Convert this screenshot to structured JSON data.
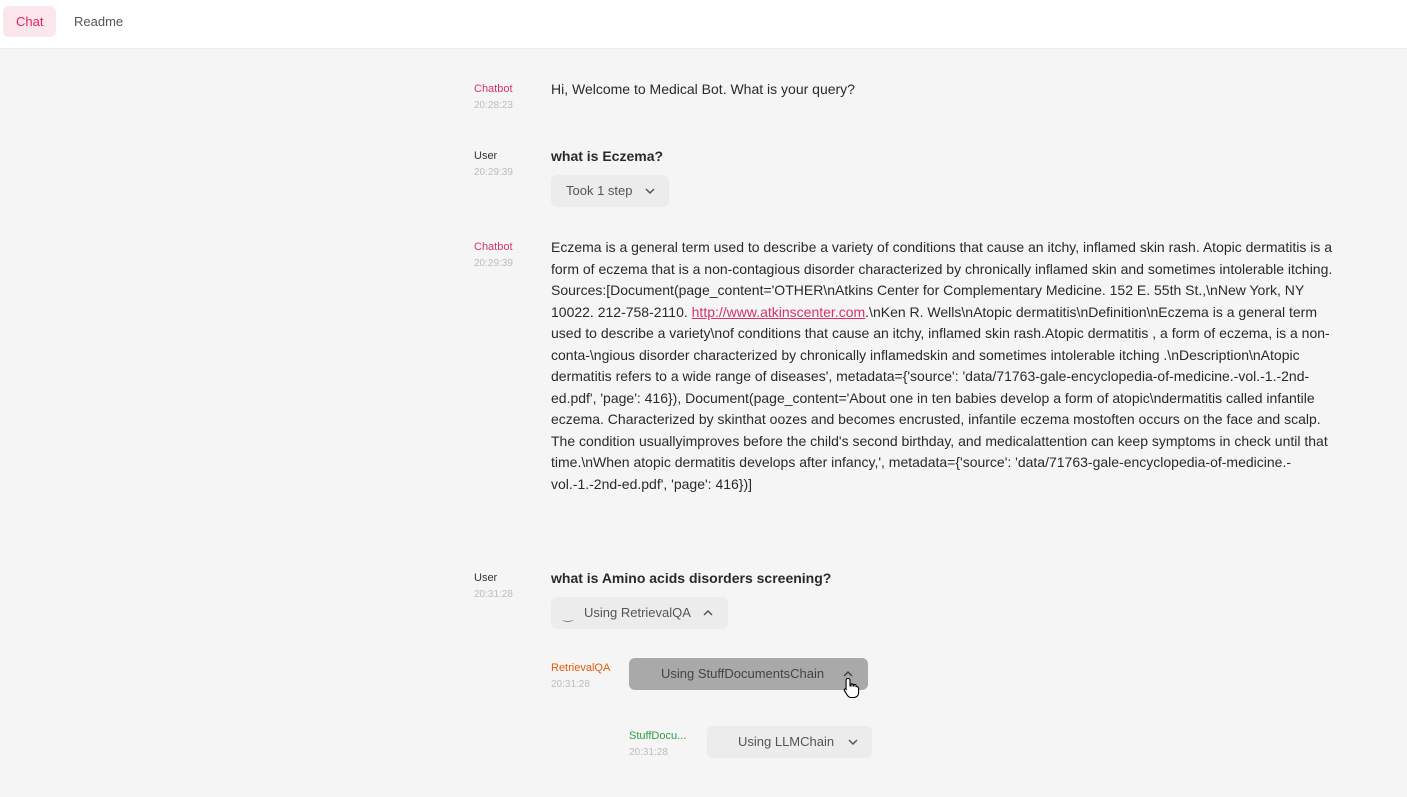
{
  "tabs": [
    {
      "label": "Chat",
      "active": true
    },
    {
      "label": "Readme",
      "active": false
    }
  ],
  "messages": [
    {
      "author": "Chatbot",
      "time": "20:28:23",
      "text": "Hi, Welcome to Medical Bot. What is your query?"
    },
    {
      "author": "User",
      "time": "20:29:39",
      "text": "what is Eczema?",
      "step_label": "Took 1 step"
    },
    {
      "author": "Chatbot",
      "time": "20:29:39",
      "text_before_link": "Eczema is a general term used to describe a variety of conditions that cause an itchy, inflamed skin rash. Atopic dermatitis is a form of eczema that is a non-contagious disorder characterized by chronically inflamed skin and sometimes intolerable itching.\nSources:[Document(page_content='OTHER\\nAtkins Center for Complementary Medicine. 152 E. 55th St.,\\nNew York, NY 10022. 212-758-2110. ",
      "link": "http://www.atkinscenter.com",
      "text_after_link": ".\\nKen R. Wells\\nAtopic dermatitis\\nDefinition\\nEczema is a general term used to describe a variety\\nof conditions that cause an itchy, inflamed skin rash.Atopic dermatitis , a form of eczema, is a non-conta-\\ngious disorder characterized by chronically inflamedskin and sometimes intolerable itching .\\nDescription\\nAtopic dermatitis refers to a wide range of diseases', metadata={'source': 'data/71763-gale-encyclopedia-of-medicine.-vol.-1.-2nd-ed.pdf', 'page': 416}), Document(page_content='About one in ten babies develop a form of atopic\\ndermatitis called infantile eczema. Characterized by skinthat oozes and becomes encrusted, infantile eczema mostoften occurs on the face and scalp. The condition usuallyimproves before the child's second birthday, and medicalattention can keep symptoms in check until that time.\\nWhen atopic dermatitis develops after infancy,', metadata={'source': 'data/71763-gale-encyclopedia-of-medicine.-vol.-1.-2nd-ed.pdf', 'page': 416})]"
    },
    {
      "author": "User",
      "time": "20:31:28",
      "text": "what is Amino acids disorders screening?",
      "step_label": "Using RetrievalQA"
    }
  ],
  "steps": [
    {
      "author": "RetrievalQA",
      "time": "20:31:28",
      "step_label": "Using StuffDocumentsChain"
    },
    {
      "author": "StuffDocu...",
      "time": "20:31:28",
      "step_label": "Using LLMChain"
    }
  ],
  "icons": {
    "chevron_down": "chevron-down-icon",
    "chevron_up": "chevron-up-icon",
    "cursor": "hand-cursor-icon"
  }
}
